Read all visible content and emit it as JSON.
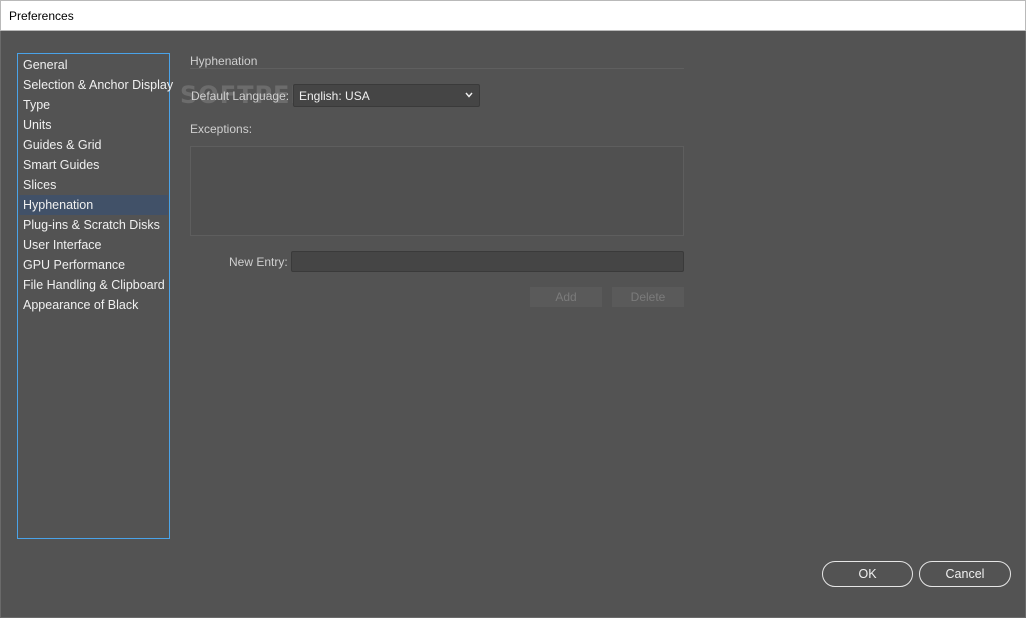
{
  "window": {
    "title": "Preferences"
  },
  "sidebar": {
    "items": [
      {
        "label": "General",
        "selected": false
      },
      {
        "label": "Selection & Anchor Display",
        "selected": false
      },
      {
        "label": "Type",
        "selected": false
      },
      {
        "label": "Units",
        "selected": false
      },
      {
        "label": "Guides & Grid",
        "selected": false
      },
      {
        "label": "Smart Guides",
        "selected": false
      },
      {
        "label": "Slices",
        "selected": false
      },
      {
        "label": "Hyphenation",
        "selected": true
      },
      {
        "label": "Plug-ins & Scratch Disks",
        "selected": false
      },
      {
        "label": "User Interface",
        "selected": false
      },
      {
        "label": "GPU Performance",
        "selected": false
      },
      {
        "label": "File Handling & Clipboard",
        "selected": false
      },
      {
        "label": "Appearance of Black",
        "selected": false
      }
    ]
  },
  "panel": {
    "title": "Hyphenation",
    "default_language_label": "Default Language:",
    "default_language_value": "English: USA",
    "exceptions_label": "Exceptions:",
    "new_entry_label": "New Entry:",
    "new_entry_value": "",
    "add_label": "Add",
    "delete_label": "Delete"
  },
  "watermark": "SOFTPEDIA",
  "footer": {
    "ok_label": "OK",
    "cancel_label": "Cancel"
  },
  "colors": {
    "accent": "#4aa3e8",
    "selection": "#415168",
    "background": "#535353"
  }
}
